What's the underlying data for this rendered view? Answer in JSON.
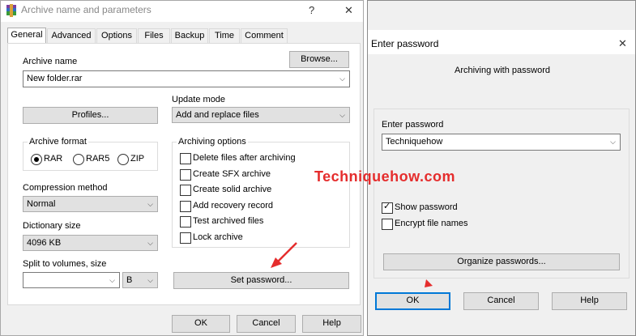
{
  "left_dialog": {
    "title": "Archive name and parameters",
    "help_glyph": "?",
    "close_glyph": "✕",
    "tabs": [
      "General",
      "Advanced",
      "Options",
      "Files",
      "Backup",
      "Time",
      "Comment"
    ],
    "archive_name_label": "Archive name",
    "browse_label": "Browse...",
    "archive_name_value": "New folder.rar",
    "update_mode_label": "Update mode",
    "update_mode_value": "Add and replace files",
    "profiles_label": "Profiles...",
    "archive_format_label": "Archive format",
    "formats": [
      {
        "label": "RAR",
        "selected": true
      },
      {
        "label": "RAR5",
        "selected": false
      },
      {
        "label": "ZIP",
        "selected": false
      }
    ],
    "archiving_options_label": "Archiving options",
    "options": [
      {
        "label": "Delete files after archiving",
        "checked": false
      },
      {
        "label": "Create SFX archive",
        "checked": false
      },
      {
        "label": "Create solid archive",
        "checked": false
      },
      {
        "label": "Add recovery record",
        "checked": false
      },
      {
        "label": "Test archived files",
        "checked": false
      },
      {
        "label": "Lock archive",
        "checked": false
      }
    ],
    "compression_method_label": "Compression method",
    "compression_method_value": "Normal",
    "dictionary_size_label": "Dictionary size",
    "dictionary_size_value": "4096 KB",
    "split_label": "Split to volumes, size",
    "split_value": "",
    "split_unit": "B",
    "set_password_label": "Set password...",
    "ok_label": "OK",
    "cancel_label": "Cancel",
    "help_label": "Help"
  },
  "right_dialog": {
    "title": "Enter password",
    "close_glyph": "✕",
    "subtitle": "Archiving with password",
    "enter_password_label": "Enter password",
    "password_value": "Techniquehow",
    "show_password_label": "Show password",
    "show_password_checked": true,
    "encrypt_names_label": "Encrypt file names",
    "encrypt_names_checked": false,
    "organize_label": "Organize passwords...",
    "ok_label": "OK",
    "cancel_label": "Cancel",
    "help_label": "Help"
  },
  "watermark": "Techniquehow.com",
  "colors": {
    "accent": "#0078d7",
    "arrow": "#e52d2d",
    "dialog_bg": "#f0f0f0"
  }
}
